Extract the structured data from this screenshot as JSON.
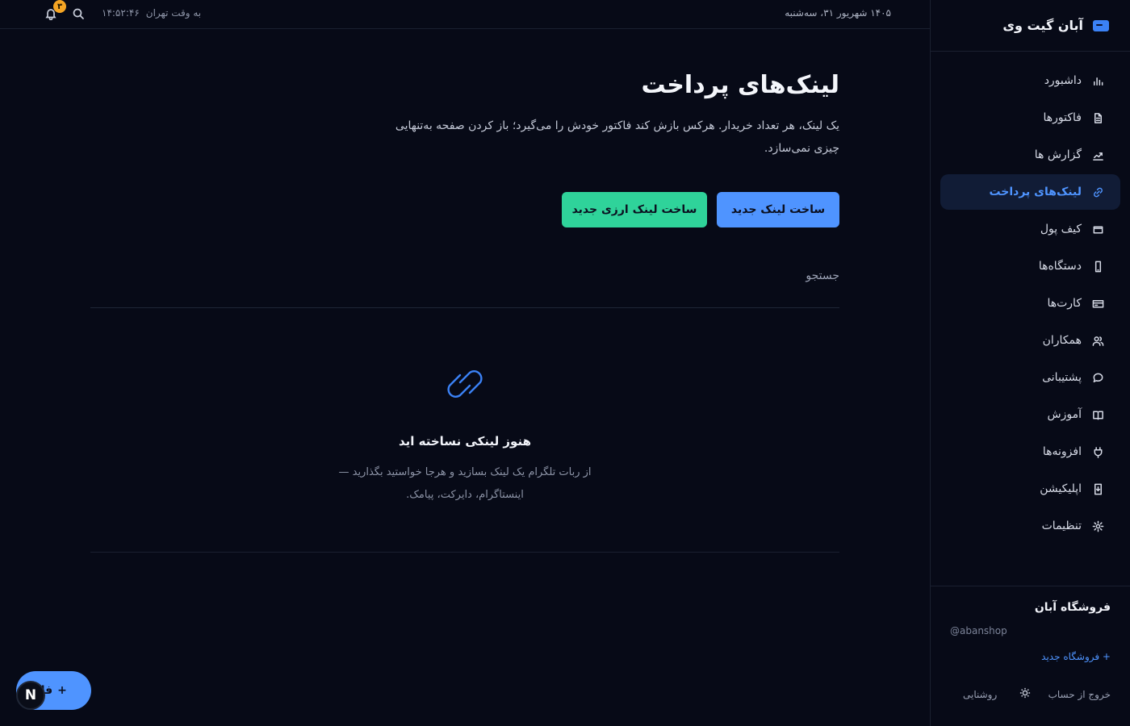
{
  "brand": {
    "title": "آبان گیت وی"
  },
  "topbar": {
    "date": "۱۴۰۵ شهریور ۳۱، سه‌شنبه",
    "clock_label": "به وقت تهران",
    "clock_time": "۱۴:۵۲:۴۶",
    "notification_count": "۳"
  },
  "sidebar": {
    "items": [
      {
        "label": "داشبورد",
        "icon": "bar-chart-icon"
      },
      {
        "label": "فاکتورها",
        "icon": "document-icon"
      },
      {
        "label": "گزارش ها",
        "icon": "trend-icon"
      },
      {
        "label": "لینک‌های پرداخت",
        "icon": "link-icon",
        "active": true
      },
      {
        "label": "کیف پول",
        "icon": "wallet-icon"
      },
      {
        "label": "دستگاه‌ها",
        "icon": "phone-icon"
      },
      {
        "label": "کارت‌ها",
        "icon": "card-icon"
      },
      {
        "label": "همکاران",
        "icon": "users-icon"
      },
      {
        "label": "پشتیبانی",
        "icon": "chat-icon"
      },
      {
        "label": "آموزش",
        "icon": "book-icon"
      },
      {
        "label": "افزونه‌ها",
        "icon": "plug-icon"
      },
      {
        "label": "اپلیکیشن",
        "icon": "app-download-icon"
      },
      {
        "label": "تنظیمات",
        "icon": "gear-icon"
      }
    ],
    "shop": {
      "name": "فروشگاه آبان",
      "handle": "@abanshop",
      "new_shop": "+ فروشگاه جدید",
      "logout": "خروج از حساب",
      "theme_label": "روشنایی"
    }
  },
  "main": {
    "title": "لینک‌های پرداخت",
    "description": "یک لینک، هر تعداد خریدار. هرکس بازش کند فاکتور خودش را می‌گیرد؛ باز کردن صفحه به‌تنهایی چیزی نمی‌سازد.",
    "new_link_button": "ساخت لینک جدید",
    "new_crypto_link_button": "ساخت لینک ارزی جدید",
    "search_placeholder": "جستجو",
    "empty": {
      "title": "هنوز لینکی نساخته اید",
      "description": "از ربات تلگرام یک لینک بسازید و هرجا خواستید بگذارید — اینستاگرام، دایرکت، پیامک."
    }
  },
  "floating": {
    "fab_plus": "+",
    "fab_label": "فاکتور",
    "n_badge": "N"
  },
  "colors": {
    "background": "#070a17",
    "accent_blue": "#4f94ff",
    "accent_green": "#2fd39a",
    "badge_orange": "#f5a524",
    "active_nav_bg": "#111c36"
  }
}
